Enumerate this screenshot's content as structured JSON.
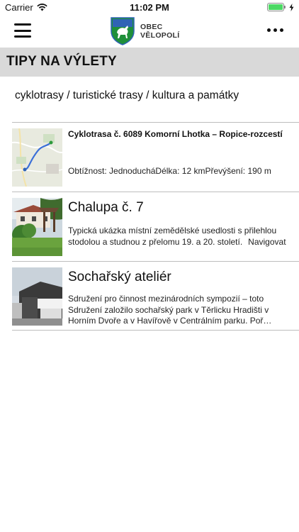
{
  "status_bar": {
    "carrier": "Carrier",
    "time": "11:02 PM",
    "battery_level": 1.0,
    "wifi_icon": "wifi-icon",
    "charging_icon": "bolt-icon"
  },
  "header": {
    "logo_line1": "OBEC",
    "logo_line2": "VĚLOPOLÍ",
    "menu_icon": "hamburger-icon",
    "more_icon": "more-dots-icon"
  },
  "section": {
    "title": "TIPY NA VÝLETY",
    "categories": "cyklotrasy / turistické trasy / kultura a památky"
  },
  "items": [
    {
      "title": "Cyklotrasa č. 6089 Komorní Lhotka – Ropice-rozcestí",
      "description": "Obtížnost: JednoducháDélka: 12 kmPřevýšení: 190 m",
      "thumbnail": "map-thumbnail"
    },
    {
      "title": "Chalupa č. 7",
      "description": "Typická ukázka místní zemědělské usedlosti s přilehlou stodolou a studnou z přelomu 19. a 20. století.",
      "link": "Navigovat",
      "thumbnail": "cottage-photo"
    },
    {
      "title": "Sochařský ateliér",
      "description": "Sdružení pro činnost mezinárodních sympozií – toto Sdružení založilo sochařský park v Těrlicku Hradišti v Horním Dvoře a v Havířově v Centrálním parku. Poř…",
      "thumbnail": "studio-photo"
    }
  ],
  "colors": {
    "section_header_bg": "#d9d9d9",
    "divider": "#bdbdbd",
    "logo_green": "#1f8f3a",
    "logo_blue": "#2f63b5",
    "battery_green": "#4cd964"
  }
}
